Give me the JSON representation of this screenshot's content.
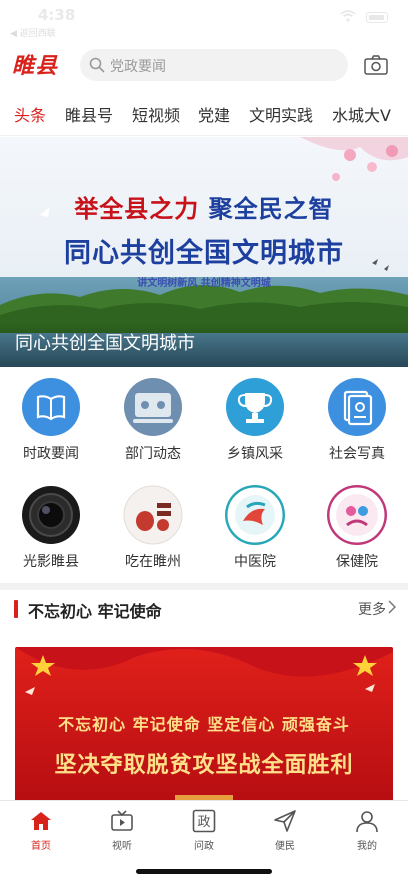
{
  "status_bar": {
    "time": "4:38",
    "back_label": "◀ 返回西联"
  },
  "header": {
    "logo": "睢县",
    "search_placeholder": "党政要闻",
    "icons": {
      "search": "search-icon",
      "camera": "camera-icon"
    }
  },
  "tabs": [
    {
      "label": "头条",
      "active": true
    },
    {
      "label": "睢县号",
      "active": false
    },
    {
      "label": "短视频",
      "active": false
    },
    {
      "label": "党建",
      "active": false
    },
    {
      "label": "文明实践",
      "active": false
    },
    {
      "label": "水城大V",
      "active": false
    }
  ],
  "banner": {
    "line1_a": "举全县之力",
    "line1_b": "聚全民之智",
    "line2": "同心共创全国文明城市",
    "line3": "讲文明树新风  共创精神文明城",
    "caption": "同心共创全国文明城市"
  },
  "grid": [
    {
      "label": "时政要闻",
      "icon": "book-icon",
      "color": "#3d8fe0"
    },
    {
      "label": "部门动态",
      "icon": "meeting-icon",
      "color": "#6f8fb0"
    },
    {
      "label": "乡镇风采",
      "icon": "trophy-icon",
      "color": "#2f9fd8"
    },
    {
      "label": "社会写真",
      "icon": "document-icon",
      "color": "#3d8fe0"
    },
    {
      "label": "光影睢县",
      "icon": "camera-lens-icon",
      "color": "#111111"
    },
    {
      "label": "吃在睢州",
      "icon": "food-icon",
      "color": "#c43a2f"
    },
    {
      "label": "中医院",
      "icon": "hospital-logo-icon",
      "color": "#28a7b8"
    },
    {
      "label": "保健院",
      "icon": "health-center-logo-icon",
      "color": "#c0387a"
    }
  ],
  "section": {
    "title": "不忘初心  牢记使命",
    "more_label": "更多"
  },
  "promo": {
    "line1": "不忘初心 牢记使命 坚定信心 顽强奋斗",
    "line2": "坚决夺取脱贫攻坚战全面胜利"
  },
  "bottom_nav": [
    {
      "label": "首页",
      "icon": "home-icon",
      "active": true
    },
    {
      "label": "视听",
      "icon": "tv-icon",
      "active": false
    },
    {
      "label": "问政",
      "icon": "politics-icon",
      "active": false
    },
    {
      "label": "便民",
      "icon": "send-icon",
      "active": false
    },
    {
      "label": "我的",
      "icon": "user-icon",
      "active": false
    }
  ],
  "colors": {
    "accent": "#d8231c",
    "banner_blue": "#1d3f9e",
    "promo_red": "#c8121a"
  }
}
